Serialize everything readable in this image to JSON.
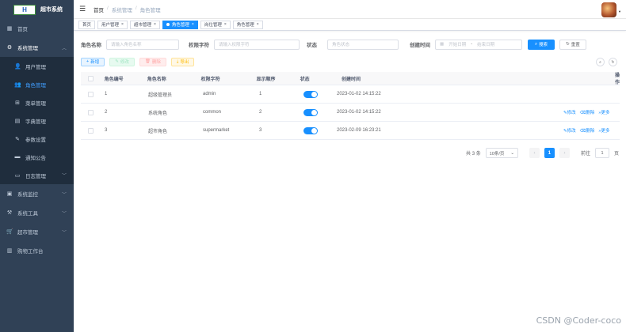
{
  "app": {
    "logo_text": "H",
    "title": "超市系统"
  },
  "sidebar": {
    "items": [
      {
        "label": "首页",
        "icon": "dashboard-icon"
      },
      {
        "label": "系统管理",
        "icon": "gear-icon",
        "open": true
      },
      {
        "label": "系统监控",
        "icon": "monitor-icon"
      },
      {
        "label": "系统工具",
        "icon": "tool-icon"
      },
      {
        "label": "超市管理",
        "icon": "cart-icon"
      },
      {
        "label": "购物工作台",
        "icon": "workbench-icon"
      }
    ],
    "sub_items": [
      {
        "label": "用户管理",
        "icon": "user-icon"
      },
      {
        "label": "角色管理",
        "icon": "users-icon",
        "active": true
      },
      {
        "label": "菜单管理",
        "icon": "tree-icon"
      },
      {
        "label": "字典管理",
        "icon": "dict-icon"
      },
      {
        "label": "参数设置",
        "icon": "edit-icon"
      },
      {
        "label": "通知公告",
        "icon": "message-icon"
      },
      {
        "label": "日志管理",
        "icon": "log-icon"
      }
    ]
  },
  "breadcrumb": [
    "首页",
    "系统管理",
    "角色管理"
  ],
  "tags": [
    {
      "label": "首页",
      "closable": false
    },
    {
      "label": "用户管理",
      "closable": true
    },
    {
      "label": "超市管理",
      "closable": true
    },
    {
      "label": "角色管理",
      "closable": true,
      "active": true
    },
    {
      "label": "岗位管理",
      "closable": true
    },
    {
      "label": "角色管理",
      "closable": true
    }
  ],
  "search": {
    "role_name_label": "角色名称",
    "role_name_placeholder": "请输入角色名称",
    "role_key_label": "权限字符",
    "role_key_placeholder": "请输入权限字符",
    "status_label": "状态",
    "status_placeholder": "角色状态",
    "time_label": "创建时间",
    "start_placeholder": "开始日期",
    "dash": "-",
    "end_placeholder": "结束日期",
    "search_btn": "搜索",
    "reset_btn": "重置"
  },
  "toolbar": {
    "add": "新增",
    "edit": "修改",
    "delete": "删除",
    "export": "导出"
  },
  "table": {
    "columns": [
      "角色编号",
      "角色名称",
      "权限字符",
      "显示顺序",
      "状态",
      "创建时间",
      "操作"
    ],
    "rows": [
      {
        "id": "1",
        "name": "超级管理员",
        "key": "admin",
        "sort": "1",
        "enabled": true,
        "time": "2023-01-02 14:15:22",
        "ops": []
      },
      {
        "id": "2",
        "name": "系统角色",
        "key": "common",
        "sort": "2",
        "enabled": true,
        "time": "2023-01-02 14:15:22",
        "ops": [
          "修改",
          "删除",
          "更多"
        ]
      },
      {
        "id": "3",
        "name": "超市角色",
        "key": "supermarket",
        "sort": "3",
        "enabled": true,
        "time": "2023-02-09 16:23:21",
        "ops": [
          "修改",
          "删除",
          "更多"
        ]
      }
    ]
  },
  "pagination": {
    "total": "共 3 条",
    "page_size": "10条/页",
    "current": "1",
    "goto_label": "前往",
    "goto_value": "1",
    "page_unit": "页"
  },
  "watermark": "CSDN @Coder-coco",
  "colors": {
    "sidebar_bg": "#304156",
    "primary": "#1890ff"
  }
}
